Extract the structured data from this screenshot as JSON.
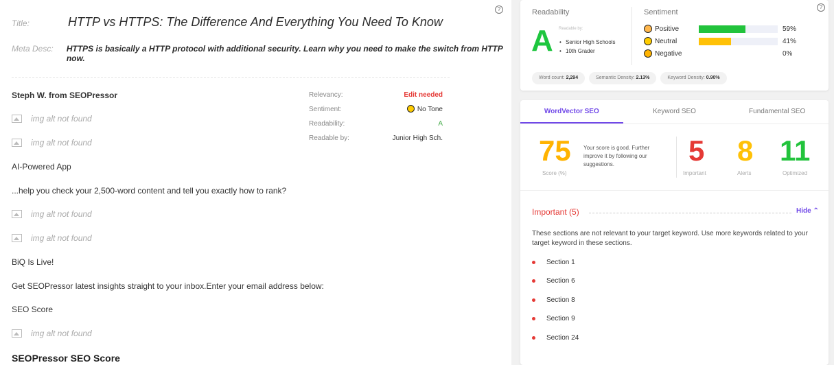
{
  "meta": {
    "title_label": "Title:",
    "title_value": "HTTP vs HTTPS: The Difference And Everything You Need To Know",
    "desc_label": "Meta Desc:",
    "desc_value": "HTTPS is basically a HTTP protocol with additional security. Learn why you need to make the switch from HTTP now."
  },
  "help_icon_glyph": "?",
  "content": {
    "author": "Steph W. from SEOPressor",
    "img_alt_missing": "img alt not found",
    "line_ai": "AI-Powered App",
    "line_help": "...help you check your 2,500-word content and tell you exactly how to rank?",
    "line_biq": "BiQ Is Live!",
    "line_get": "Get SEOPressor latest insights straight to your inbox.Enter your email address below:",
    "line_score": "SEO Score",
    "line_heading": "SEOPressor SEO Score"
  },
  "stats": [
    {
      "label": "Relevancy:",
      "value": "Edit needed"
    },
    {
      "label": "Sentiment:",
      "value": "No Tone"
    },
    {
      "label": "Readability:",
      "value": "A"
    },
    {
      "label": "Readable by:",
      "value": "Junior High Sch."
    }
  ],
  "readability": {
    "title": "Readability",
    "grade": "A",
    "readable_by_label": "Readable by:",
    "readable_by": [
      "Senior High Schools",
      "10th Grader"
    ]
  },
  "sentiment": {
    "title": "Sentiment",
    "items": [
      {
        "name": "Positive",
        "pct_text": "59%",
        "pct": 59,
        "color": "#22c33c"
      },
      {
        "name": "Neutral",
        "pct_text": "41%",
        "pct": 41,
        "color": "#ffc107"
      },
      {
        "name": "Negative",
        "pct_text": "0%",
        "pct": 0,
        "color": "#e53935"
      }
    ]
  },
  "pills": [
    {
      "label": "Word count:",
      "value": "2,294"
    },
    {
      "label": "Semantic Density:",
      "value": "2.13%"
    },
    {
      "label": "Keyword Density:",
      "value": "0.90%"
    }
  ],
  "tabs": [
    "WordVector SEO",
    "Keyword SEO",
    "Fundamental SEO"
  ],
  "score": {
    "value": "75",
    "caption": "Score (%)",
    "message": "Your score is good. Further improve it by following our suggestions.",
    "important": "5",
    "important_label": "Important",
    "alerts": "8",
    "alerts_label": "Alerts",
    "optimized": "11",
    "optimized_label": "Optimized",
    "colors": {
      "score": "#ffb300",
      "important": "#e53935",
      "alerts": "#ffc107",
      "optimized": "#22c33c"
    }
  },
  "important_section": {
    "title": "Important (5)",
    "hide_label": "Hide",
    "description": "These sections are not relevant to your target keyword. Use more keywords related to your target keyword in these sections.",
    "sections": [
      "Section 1",
      "Section 6",
      "Section 8",
      "Section 9",
      "Section 24"
    ]
  }
}
